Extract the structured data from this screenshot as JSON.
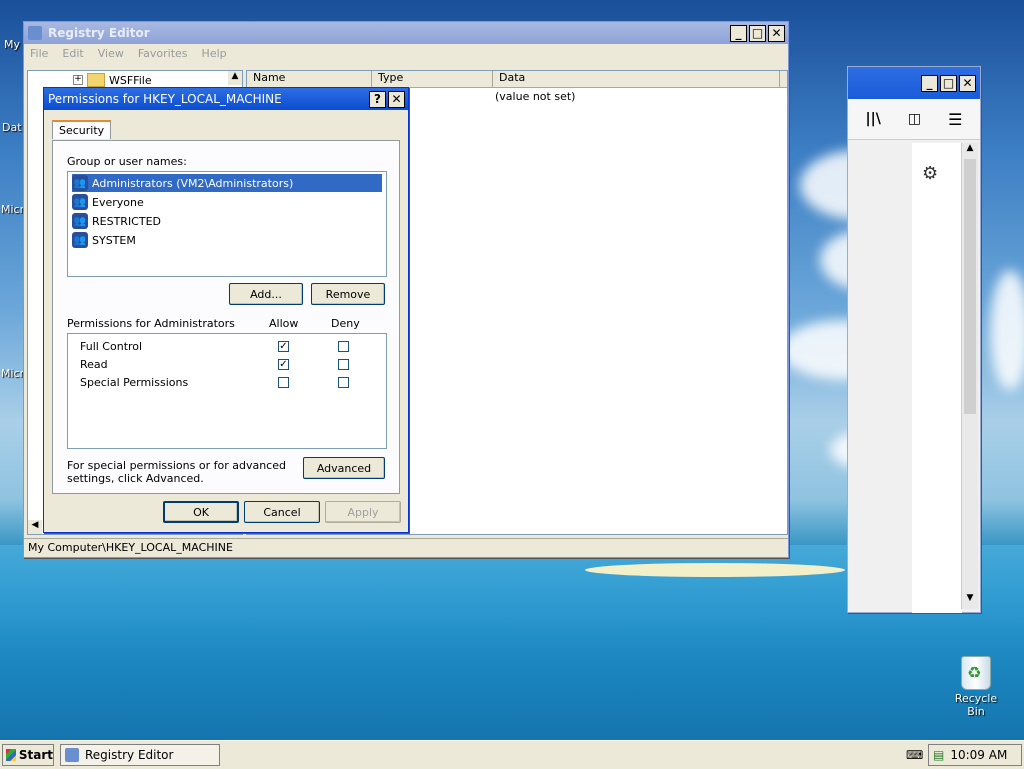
{
  "registry": {
    "title": "Registry Editor",
    "menu": [
      "File",
      "Edit",
      "View",
      "Favorites",
      "Help"
    ],
    "tree_item": "WSFFile",
    "columns": [
      "Name",
      "Type",
      "Data"
    ],
    "value_data": "(value not set)",
    "statusbar": "My Computer\\HKEY_LOCAL_MACHINE"
  },
  "permissions": {
    "title": "Permissions for HKEY_LOCAL_MACHINE",
    "tab": "Security",
    "group_label": "Group or user names:",
    "users": [
      "Administrators (VM2\\Administrators)",
      "Everyone",
      "RESTRICTED",
      "SYSTEM"
    ],
    "selected_user_index": 0,
    "add_label": "Add...",
    "remove_label": "Remove",
    "perm_header": "Permissions for Administrators",
    "allow_label": "Allow",
    "deny_label": "Deny",
    "rows": [
      {
        "name": "Full Control",
        "allow": true,
        "deny": false
      },
      {
        "name": "Read",
        "allow": true,
        "deny": false
      },
      {
        "name": "Special Permissions",
        "allow": false,
        "deny": false
      }
    ],
    "advanced_text": "For special permissions or for advanced settings, click Advanced.",
    "advanced_label": "Advanced",
    "ok_label": "OK",
    "cancel_label": "Cancel",
    "apply_label": "Apply"
  },
  "desktop": {
    "left_labels": [
      "My",
      "Dat",
      "Micr",
      "Micr"
    ],
    "recycle_bin": "Recycle Bin"
  },
  "taskbar": {
    "start_label": "Start",
    "task_label": "Registry Editor",
    "clock": "10:09 AM"
  },
  "browser_window": {
    "icons": [
      "library-icon",
      "sidebar-icon",
      "menu-icon",
      "gear-icon"
    ]
  }
}
